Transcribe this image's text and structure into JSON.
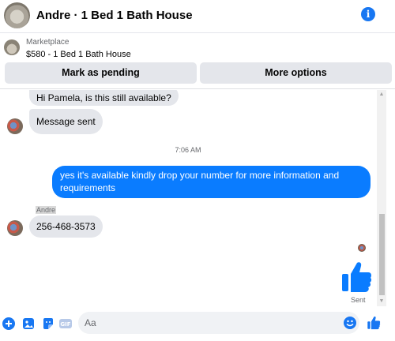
{
  "header": {
    "title": "Andre · 1 Bed 1 Bath House"
  },
  "marketplace": {
    "label": "Marketplace",
    "listing": "$580 - 1 Bed 1 Bath House",
    "pending_label": "Mark as pending",
    "more_label": "More options"
  },
  "messages": {
    "incoming_1": "Hi Pamela, is this still available?",
    "incoming_2": "Message sent",
    "timestamp": "7:06 AM",
    "outgoing_1": "yes it's available kindly drop your number for more information and requirements",
    "sender_name": "Andre",
    "incoming_3": "256-468-3573",
    "status": "Sent"
  },
  "composer": {
    "placeholder": "Aa"
  },
  "colors": {
    "accent": "#0a7cff",
    "icon_blue": "#1877f2",
    "bubble_gray": "#e4e6eb"
  },
  "icons": [
    "info-icon",
    "plus-icon",
    "photo-icon",
    "sticker-icon",
    "gif-icon",
    "emoji-icon",
    "like-icon"
  ]
}
